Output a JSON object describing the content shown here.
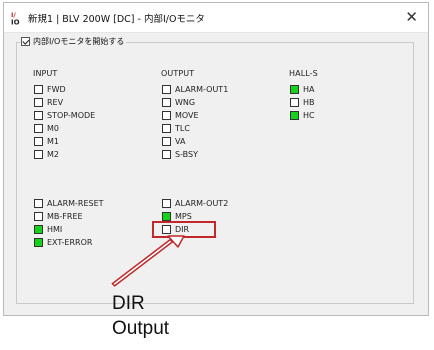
{
  "window": {
    "title": "新規1 | BLV 200W [DC] - 内部I/Oモニタ",
    "close_icon": "close-icon"
  },
  "monitor_toggle": {
    "label": "内部I/Oモニタを開始する",
    "checked": true
  },
  "headers": {
    "input": "INPUT",
    "output": "OUTPUT",
    "halls": "HALL-S"
  },
  "inputs": [
    {
      "label": "FWD",
      "on": false
    },
    {
      "label": "REV",
      "on": false
    },
    {
      "label": "STOP-MODE",
      "on": false
    },
    {
      "label": "M0",
      "on": false
    },
    {
      "label": "M1",
      "on": false
    },
    {
      "label": "M2",
      "on": false
    }
  ],
  "outputs": [
    {
      "label": "ALARM-OUT1",
      "on": false
    },
    {
      "label": "WNG",
      "on": false
    },
    {
      "label": "MOVE",
      "on": false
    },
    {
      "label": "TLC",
      "on": false
    },
    {
      "label": "VA",
      "on": false
    },
    {
      "label": "S-BSY",
      "on": false
    }
  ],
  "hall_sensors": [
    {
      "label": "HA",
      "on": true
    },
    {
      "label": "HB",
      "on": false
    },
    {
      "label": "HC",
      "on": true
    }
  ],
  "inputs2": [
    {
      "label": "ALARM-RESET",
      "on": false
    },
    {
      "label": "MB-FREE",
      "on": false
    },
    {
      "label": "HMI",
      "on": true
    },
    {
      "label": "EXT-ERROR",
      "on": true
    }
  ],
  "outputs2": [
    {
      "label": "ALARM-OUT2",
      "on": false
    },
    {
      "label": "MPS",
      "on": true
    },
    {
      "label": "DIR",
      "on": false
    }
  ],
  "annotation": {
    "line1": "DIR",
    "line2": "Output",
    "highlight_color": "#c0282a"
  }
}
